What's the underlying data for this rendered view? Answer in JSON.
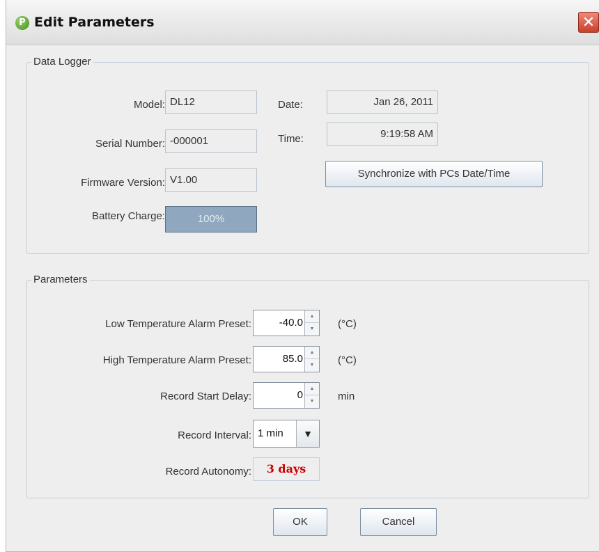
{
  "window": {
    "title": "Edit Parameters",
    "close_glyph": "✕"
  },
  "data_logger": {
    "group_title": "Data Logger",
    "model_label": "Model:",
    "model_value": "DL12",
    "serial_label": "Serial Number:",
    "serial_value": "-000001",
    "firmware_label": "Firmware Version:",
    "firmware_value": "V1.00",
    "battery_label": "Battery Charge:",
    "battery_value": "100%",
    "battery_level_percent": 100,
    "date_label": "Date:",
    "date_value": "Jan 26, 2011",
    "time_label": "Time:",
    "time_value": "9:19:58 AM",
    "sync_button": "Synchronize with PCs Date/Time"
  },
  "parameters": {
    "group_title": "Parameters",
    "low_temp_label": "Low Temperature Alarm Preset:",
    "low_temp_value": "-40.0",
    "low_temp_unit": "(°C)",
    "high_temp_label": "High Temperature Alarm Preset:",
    "high_temp_value": "85.0",
    "high_temp_unit": "(°C)",
    "start_delay_label": "Record Start Delay:",
    "start_delay_value": "0",
    "start_delay_unit": "min",
    "interval_label": "Record Interval:",
    "interval_value": "1 min",
    "autonomy_label": "Record Autonomy:",
    "autonomy_value": "3 days"
  },
  "footer": {
    "ok_label": "OK",
    "cancel_label": "Cancel"
  },
  "colors": {
    "autonomy_text": "#cc0000",
    "battery_fill": "#8fa7bf",
    "close_button": "#c9402a"
  },
  "icons": {
    "app": "app-logo-icon",
    "close": "close-icon",
    "spin_up": "spin-up-icon",
    "spin_down": "spin-down-icon",
    "dropdown": "chevron-down-icon"
  }
}
